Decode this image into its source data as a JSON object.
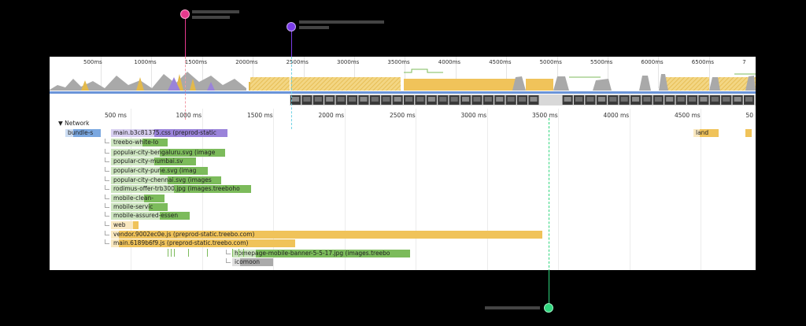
{
  "overview": {
    "ticks": [
      "500ms",
      "1000ms",
      "1500ms",
      "2000ms",
      "2500ms",
      "3000ms",
      "3500ms",
      "4000ms",
      "4500ms",
      "5000ms",
      "5500ms",
      "6000ms",
      "6500ms",
      "7"
    ]
  },
  "timeline": {
    "ticks": [
      "500 ms",
      "1000 ms",
      "1500 ms",
      "2000 ms",
      "2500 ms",
      "3000 ms",
      "3500 ms",
      "4000 ms",
      "4500 ms",
      "50"
    ]
  },
  "network": {
    "section_label": "Network",
    "requests": [
      {
        "label": "bundle-s",
        "color": "#7aa7e0"
      },
      {
        "label": "main.b3c81375.css (preprod-static",
        "color": "#9a83da"
      },
      {
        "label": "treebo-white-lo",
        "color": "#7cbb5b"
      },
      {
        "label": "popular-city-bengaluru.svg (image",
        "color": "#7cbb5b"
      },
      {
        "label": "popular-city-mumbai.sv",
        "color": "#7cbb5b"
      },
      {
        "label": "popular-city-pune.svg (imag",
        "color": "#7cbb5b"
      },
      {
        "label": "popular-city-chennai.svg (images",
        "color": "#7cbb5b"
      },
      {
        "label": "rodimus-offer-trb300.jpg (images.treeboho",
        "color": "#7cbb5b"
      },
      {
        "label": "mobile-clean-",
        "color": "#7cbb5b"
      },
      {
        "label": "mobile-servic",
        "color": "#7cbb5b"
      },
      {
        "label": "mobile-assured-essen",
        "color": "#7cbb5b"
      },
      {
        "label": "web",
        "color": "#f0c35a"
      },
      {
        "label": "vendor.9002ec0e.js (preprod-static.treebo.com)",
        "color": "#f0c35a"
      },
      {
        "label": "main.6189b6f9.js (preprod-static.treebo.com)",
        "color": "#f0c35a"
      },
      {
        "label": "homepage-mobile-banner-5-5-17.jpg (images.treebo",
        "color": "#7cbb5b"
      },
      {
        "label": "icomoon",
        "color": "#aaaaaa"
      },
      {
        "label": "land",
        "color": "#f0c35a"
      }
    ]
  },
  "markers": [
    {
      "name": "pink-marker",
      "color": "#e6398d"
    },
    {
      "name": "purple-marker",
      "color": "#7a3ce8"
    },
    {
      "name": "green-marker",
      "color": "#2fd67d"
    }
  ],
  "colors": {
    "script": "#f0c35a",
    "image": "#7cbb5b",
    "stylesheet": "#9a83da",
    "document": "#7aa7e0",
    "other": "#aaaaaa",
    "blue_band": "#6a94d8",
    "cyan_line": "#73d3e6"
  }
}
